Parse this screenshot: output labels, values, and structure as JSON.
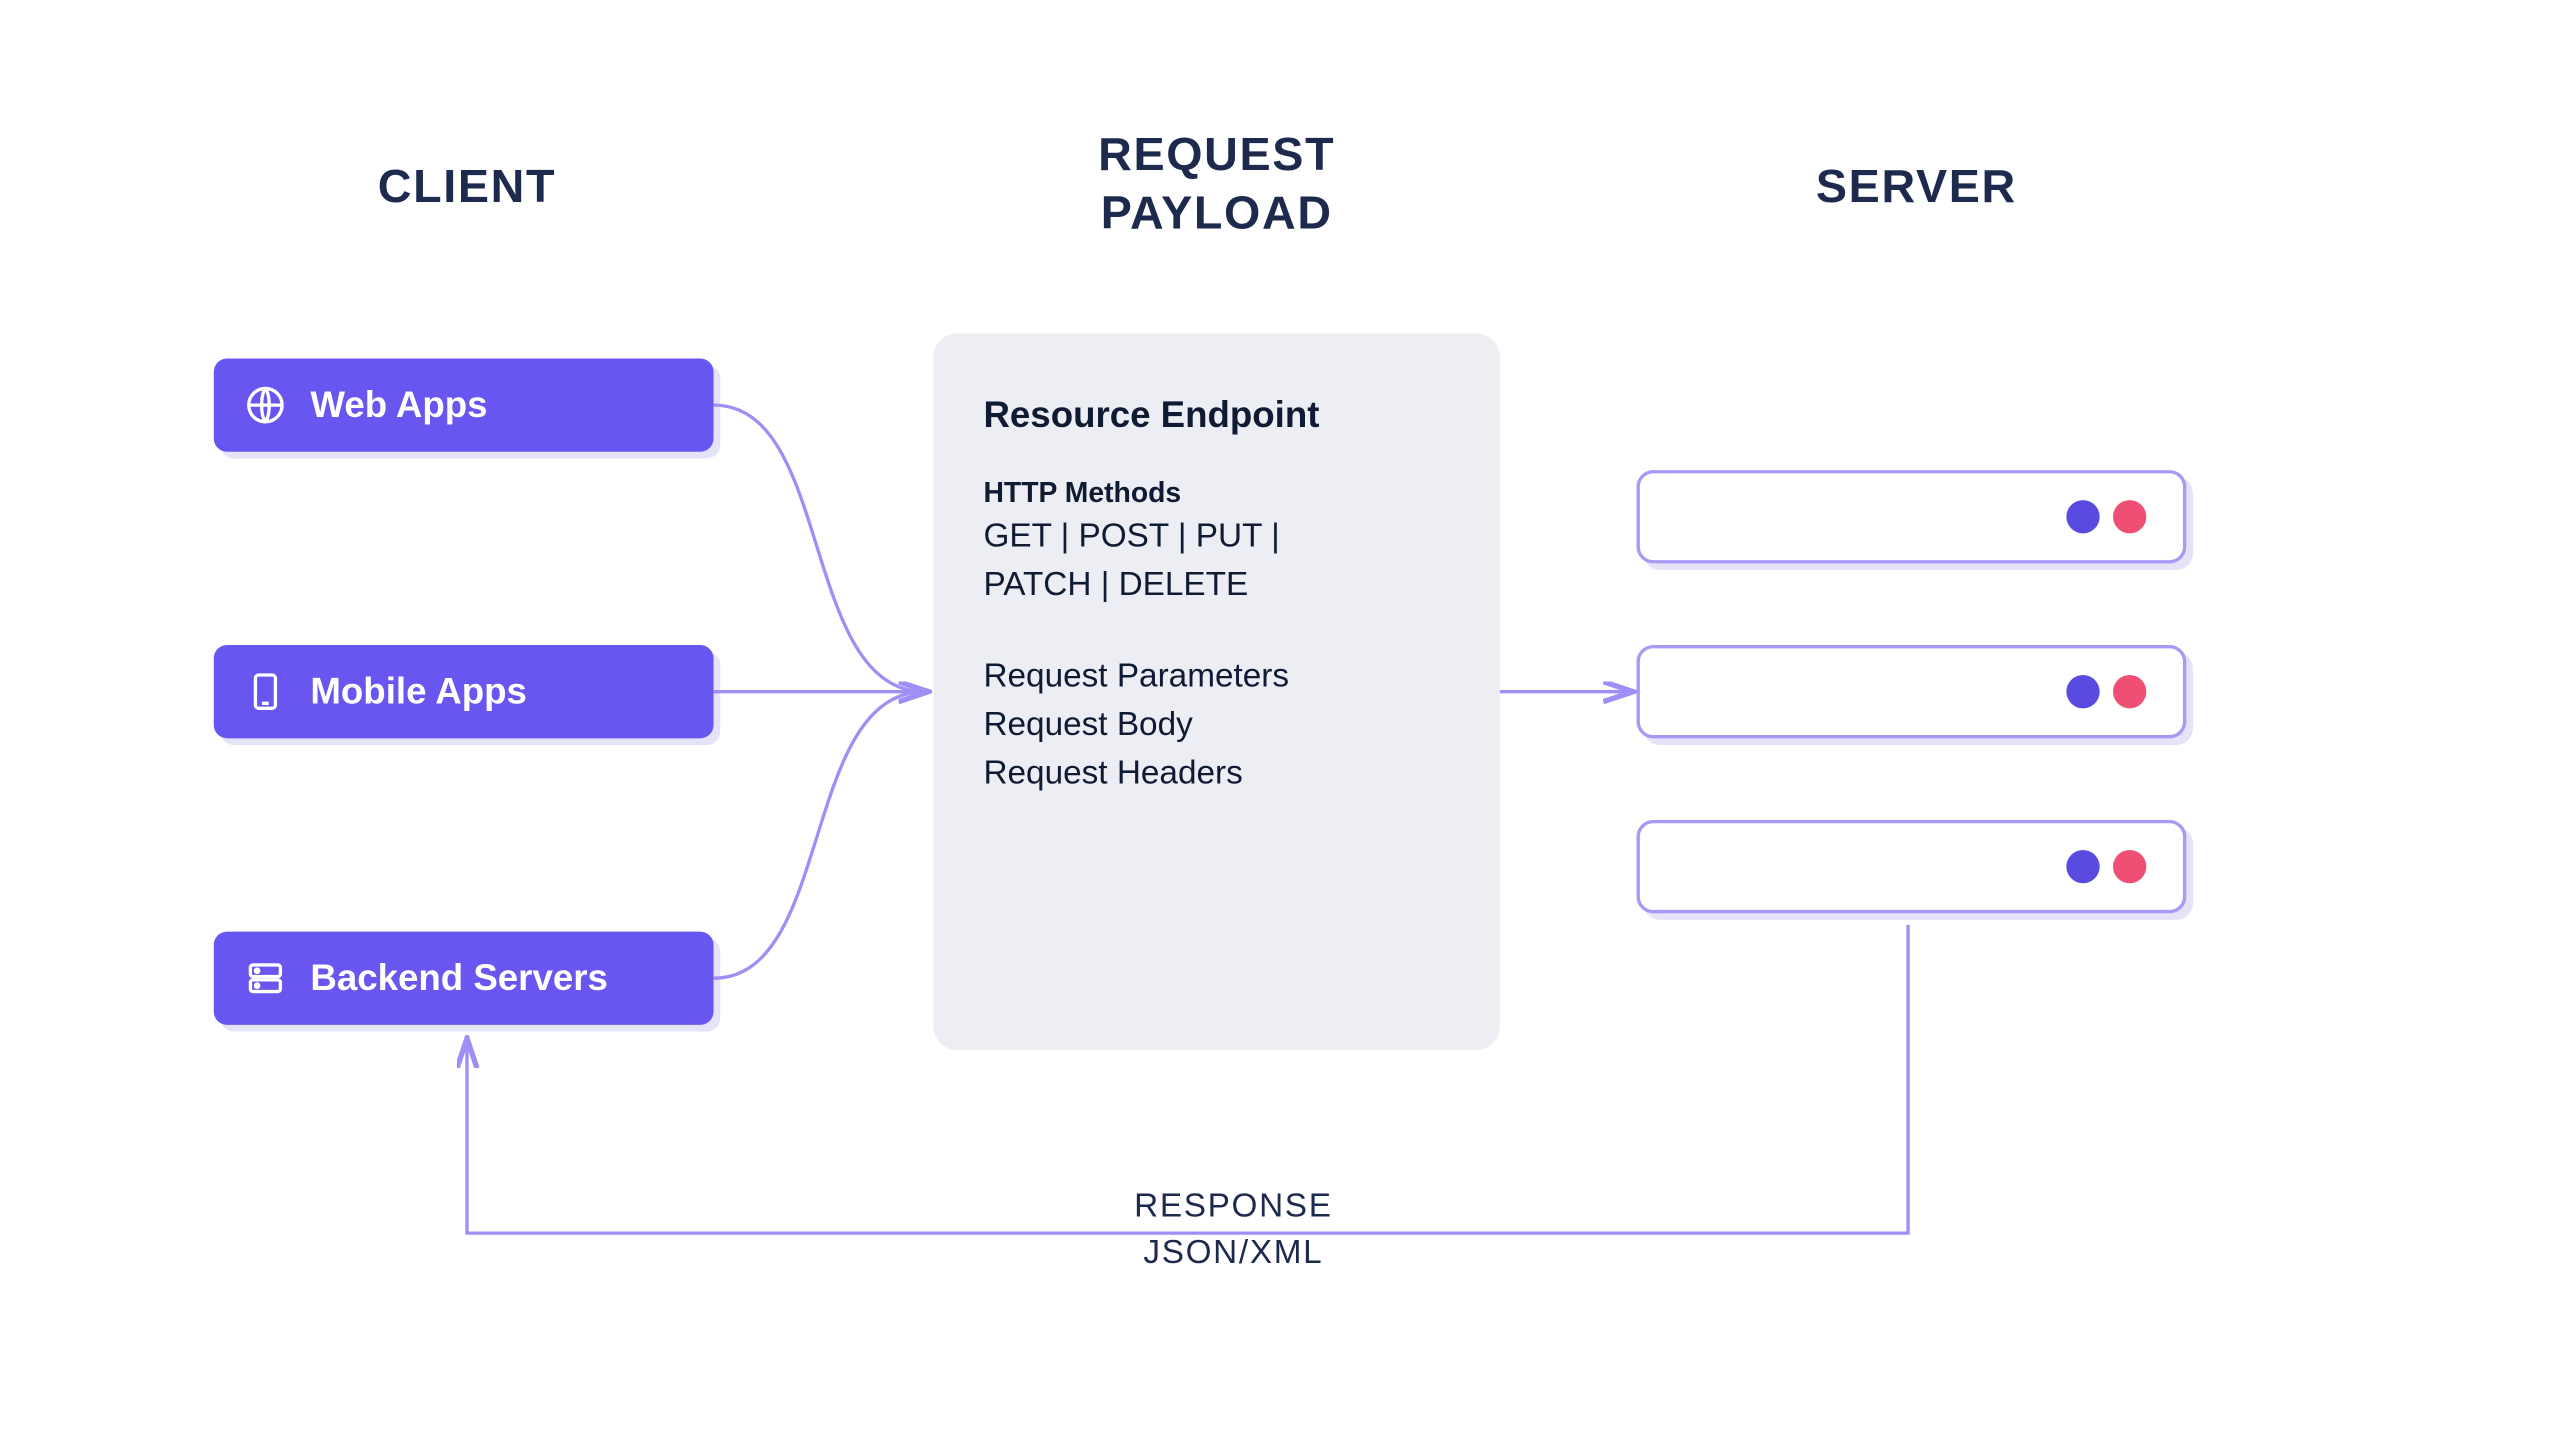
{
  "headings": {
    "client": "CLIENT",
    "request_line1": "REQUEST",
    "request_line2": "PAYLOAD",
    "server": "SERVER"
  },
  "clients": {
    "web": "Web Apps",
    "mobile": "Mobile Apps",
    "backend": "Backend Servers"
  },
  "payload": {
    "title": "Resource Endpoint",
    "http_label": "HTTP Methods",
    "http_methods": "GET | POST | PUT | PATCH | DELETE",
    "params": "Request Parameters",
    "body": "Request Body",
    "headers": "Request Headers"
  },
  "response": {
    "line1": "RESPONSE",
    "line2": "JSON/XML"
  },
  "colors": {
    "pill": "#6757f0",
    "navy": "#1d2a4d",
    "panel": "#eceef3",
    "border": "#a79af7",
    "dot_blue": "#5a4be0",
    "dot_red": "#ef4f74",
    "connector": "#9d8ff5"
  }
}
